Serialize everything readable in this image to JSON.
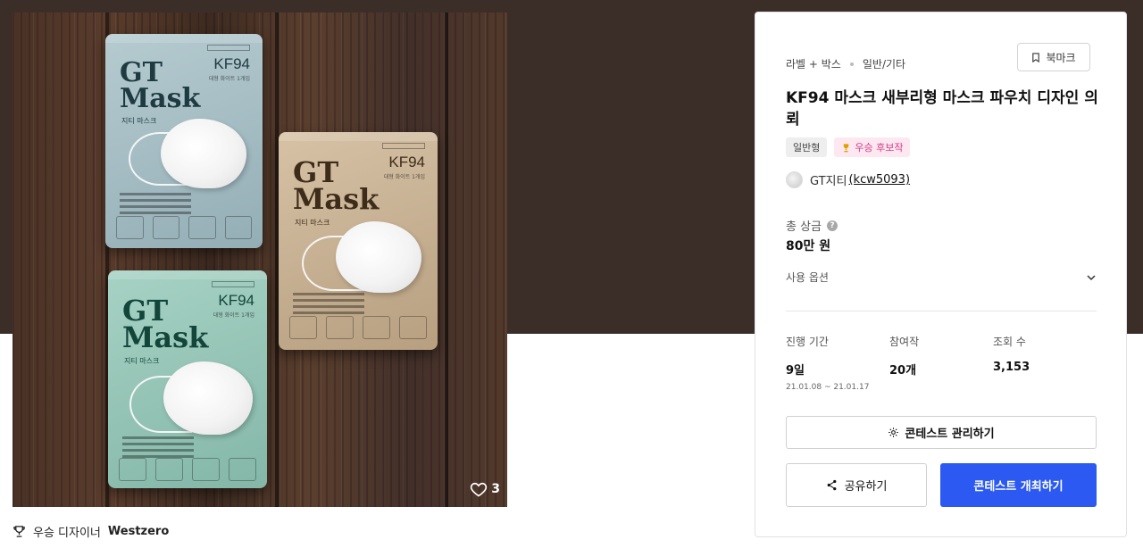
{
  "colors": {
    "hero_band": "#3b2e28",
    "primary": "#2b59f2",
    "award_pink": "#d43c86"
  },
  "gallery": {
    "like_count": "3",
    "pouches": [
      {
        "brand_line1": "GT",
        "brand_line2": "Mask",
        "spec": "KF94",
        "spec_sub": "대형 화이트 1개입",
        "sub": "지티 마스크",
        "color": "blue-gray"
      },
      {
        "brand_line1": "GT",
        "brand_line2": "Mask",
        "spec": "KF94",
        "spec_sub": "대형 화이트 1개입",
        "sub": "지티 마스크",
        "color": "beige"
      },
      {
        "brand_line1": "GT",
        "brand_line2": "Mask",
        "spec": "KF94",
        "spec_sub": "대형 화이트 1개입",
        "sub": "지티 마스크",
        "color": "mint"
      }
    ]
  },
  "designer": {
    "prefix": "우승 디자이너",
    "name": "Westzero",
    "icon": "trophy-icon"
  },
  "contest": {
    "crumb_1": "라벨 + 박스",
    "crumb_2": "일반/기타",
    "bookmark_label": "북마크",
    "title": "KF94 마스크 새부리형 마스크 파우치 디자인 의뢰",
    "tag_type": "일반형",
    "tag_award": "우승 후보작",
    "owner_name": "GT지티",
    "owner_handle": "(kcw5093)",
    "prize_label": "총 상금",
    "prize_value": "80만 원",
    "usage_label": "사용 옵션",
    "stats": {
      "period_label": "진행 기간",
      "period_value": "9일",
      "period_range": "21.01.08 ~ 21.01.17",
      "entries_label": "참여작",
      "entries_value": "20개",
      "views_label": "조회 수",
      "views_value": "3,153"
    },
    "manage_label": "콘테스트 관리하기",
    "share_label": "공유하기",
    "host_label": "콘테스트 개최하기"
  }
}
